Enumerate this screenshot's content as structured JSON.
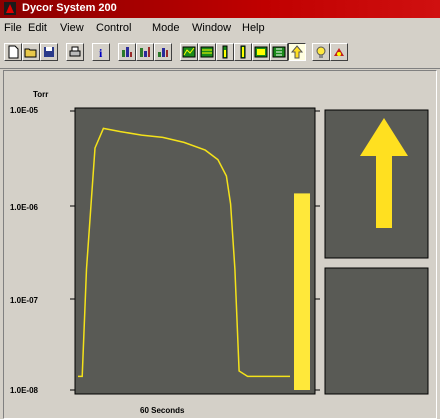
{
  "window": {
    "title": "Dycor System 200"
  },
  "menu": [
    {
      "key": "file",
      "label": "File"
    },
    {
      "key": "edit",
      "label": "Edit"
    },
    {
      "key": "view",
      "label": "View"
    },
    {
      "key": "control",
      "label": "Control"
    },
    {
      "key": "mode",
      "label": "Mode"
    },
    {
      "key": "window",
      "label": "Window"
    },
    {
      "key": "help",
      "label": "Help"
    }
  ],
  "toolbar": {
    "buttons": [
      "new-document-icon",
      "open-folder-icon",
      "save-disk-icon",
      "print-icon",
      "info-icon",
      "bar-chart-1-icon",
      "bar-chart-2-icon",
      "bar-chart-3-icon",
      "scan-view-icon",
      "trend-view-icon",
      "column-view-icon",
      "tall-bar-icon",
      "filament-icon",
      "grid-view-icon",
      "arrow-up-icon",
      "lightbulb-icon",
      "pump-icon"
    ]
  },
  "chart_data": {
    "type": "line",
    "ylabel": "Torr",
    "xlabel": "60 Seconds",
    "yscale": "log",
    "ylim": [
      1e-08,
      1e-05
    ],
    "y_ticks": [
      "1.0E-05",
      "1.0E-06",
      "1.0E-07",
      "1.0E-08"
    ],
    "x_range_seconds": [
      0,
      60
    ],
    "series": [
      {
        "color": "#f4e21a",
        "x": [
          0,
          1,
          2,
          4,
          6,
          10,
          15,
          20,
          25,
          30,
          33,
          35,
          36,
          37,
          38,
          40,
          42,
          44,
          46,
          48,
          50
        ],
        "y": [
          1.4e-08,
          1.4e-08,
          2e-07,
          4e-06,
          6.5e-06,
          6e-06,
          5.5e-06,
          5.2e-06,
          4.6e-06,
          3.8e-06,
          3e-06,
          2e-06,
          1e-06,
          2e-07,
          1.6e-08,
          1.4e-08,
          1.4e-08,
          1.4e-08,
          1.4e-08,
          1.4e-08,
          1.4e-08
        ]
      }
    ],
    "bar_level": 1.3e-06,
    "colors": {
      "plot_bg": "#595a55",
      "trace": "#f4e21a",
      "bar": "#ffe83a"
    }
  },
  "indicators": {
    "trend": "arrow-up-icon"
  }
}
